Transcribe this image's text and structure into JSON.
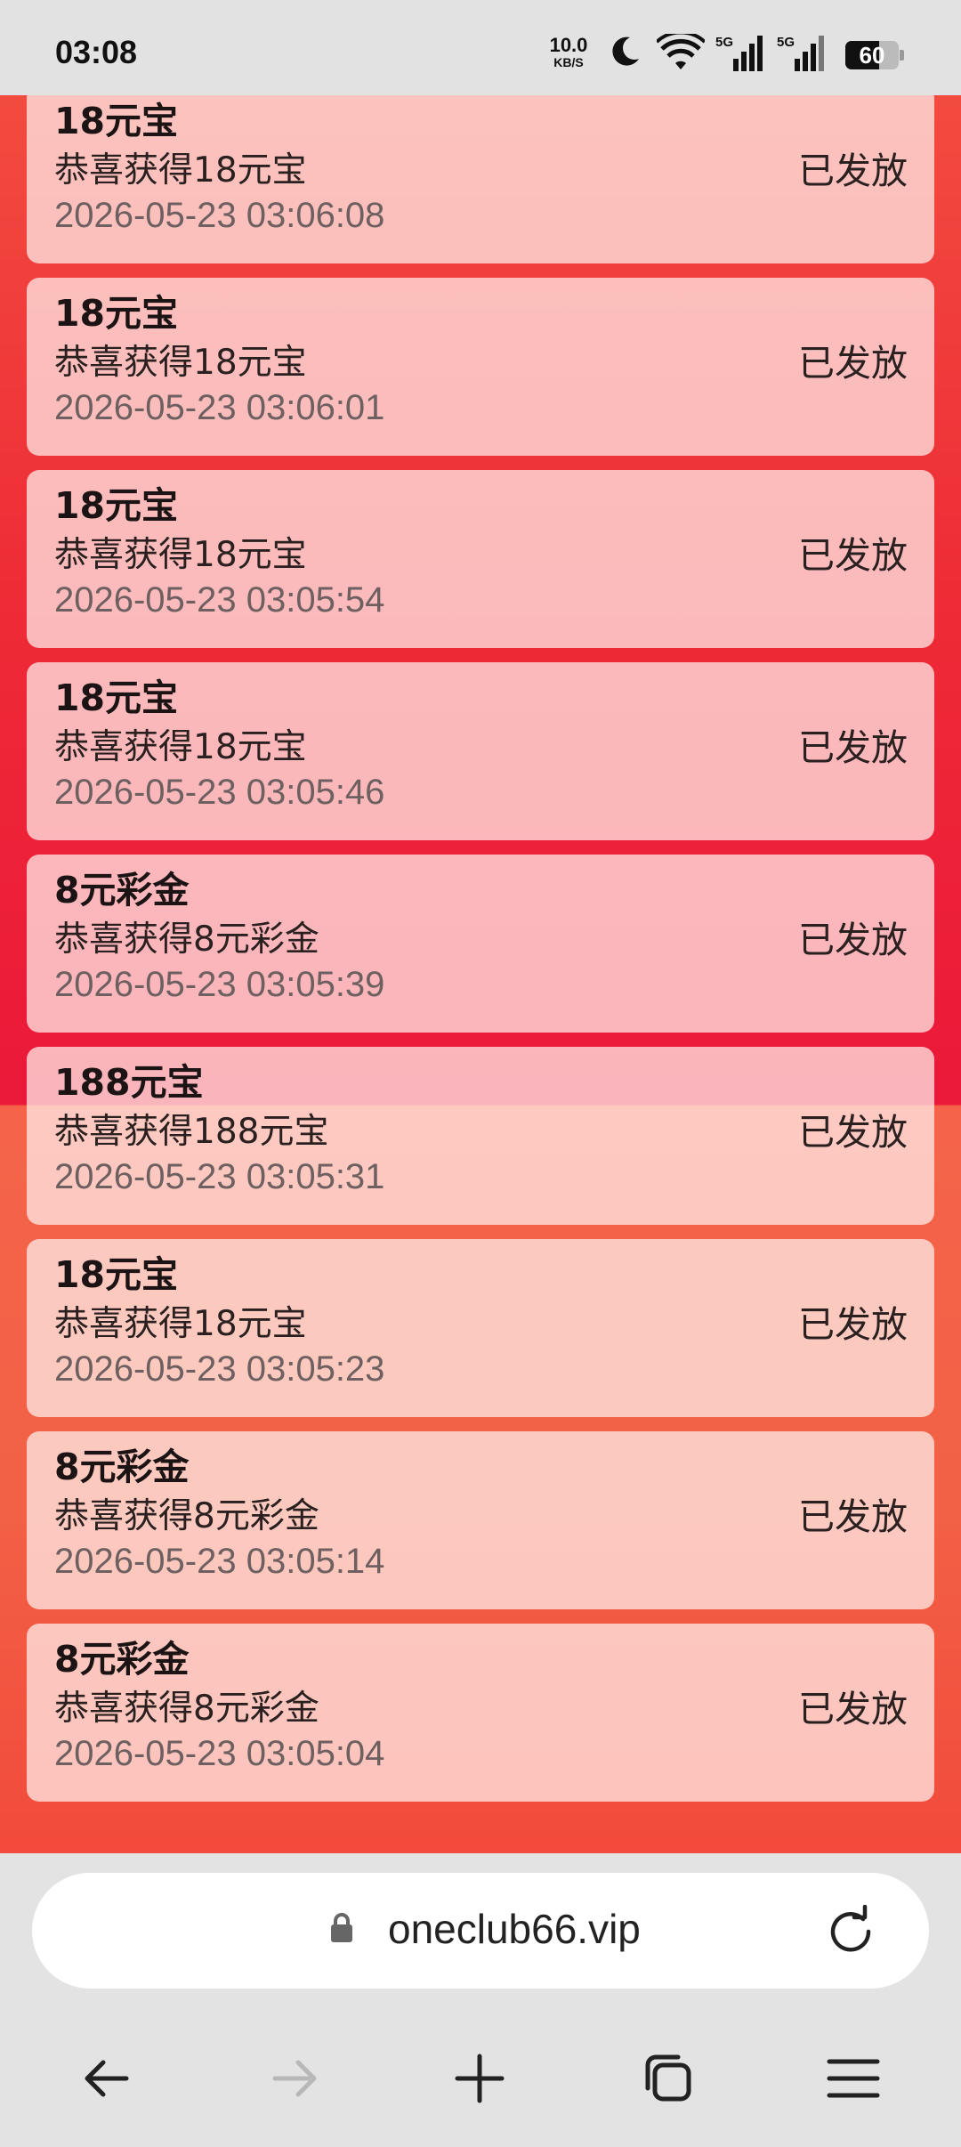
{
  "status_bar": {
    "time": "03:08",
    "net_speed_value": "10.0",
    "net_speed_unit": "KB/S",
    "battery": "60",
    "icons": [
      "moon-icon",
      "wifi-icon",
      "signal-5g-icon",
      "signal-5g-icon",
      "battery-icon"
    ]
  },
  "records": [
    {
      "title": "18元宝",
      "desc": "恭喜获得18元宝",
      "time": "2026-05-23 03:06:08",
      "status": "已发放"
    },
    {
      "title": "18元宝",
      "desc": "恭喜获得18元宝",
      "time": "2026-05-23 03:06:01",
      "status": "已发放"
    },
    {
      "title": "18元宝",
      "desc": "恭喜获得18元宝",
      "time": "2026-05-23 03:05:54",
      "status": "已发放"
    },
    {
      "title": "18元宝",
      "desc": "恭喜获得18元宝",
      "time": "2026-05-23 03:05:46",
      "status": "已发放"
    },
    {
      "title": "8元彩金",
      "desc": "恭喜获得8元彩金",
      "time": "2026-05-23 03:05:39",
      "status": "已发放"
    },
    {
      "title": "188元宝",
      "desc": "恭喜获得188元宝",
      "time": "2026-05-23 03:05:31",
      "status": "已发放"
    },
    {
      "title": "18元宝",
      "desc": "恭喜获得18元宝",
      "time": "2026-05-23 03:05:23",
      "status": "已发放"
    },
    {
      "title": "8元彩金",
      "desc": "恭喜获得8元彩金",
      "time": "2026-05-23 03:05:14",
      "status": "已发放"
    },
    {
      "title": "8元彩金",
      "desc": "恭喜获得8元彩金",
      "time": "2026-05-23 03:05:04",
      "status": "已发放"
    }
  ],
  "browser": {
    "url": "oneclub66.vip",
    "nav_icons": [
      "back-arrow-icon",
      "forward-arrow-icon",
      "new-tab-plus-icon",
      "tabs-icon",
      "menu-icon"
    ]
  },
  "colors": {
    "page_red": "#ee2a36",
    "page_orange": "#f5644a",
    "card_tint": "#fcc8c4"
  }
}
